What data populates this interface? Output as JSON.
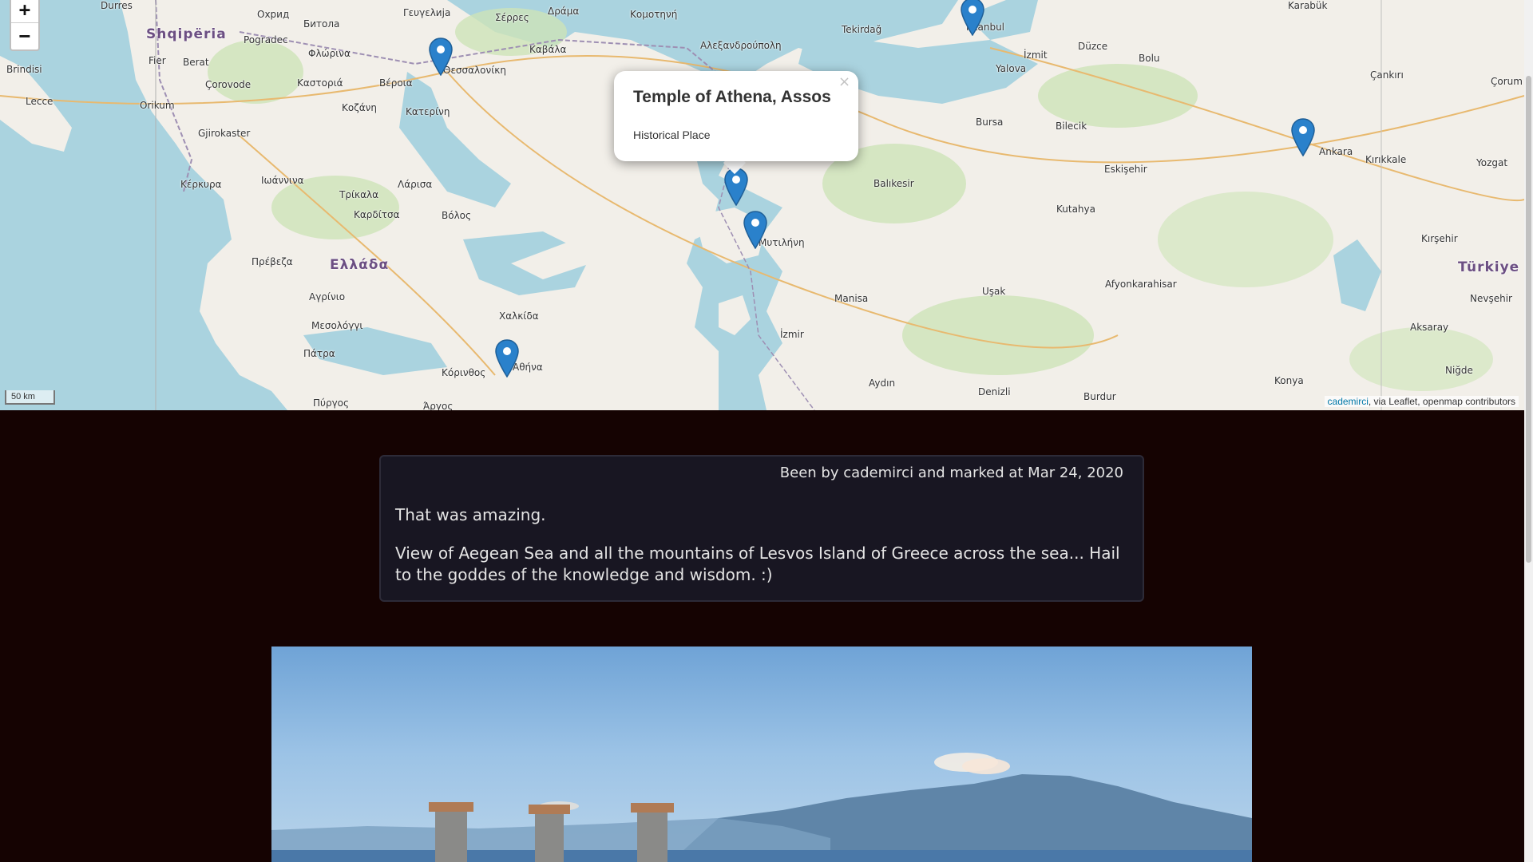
{
  "map": {
    "zoom_in": "+",
    "zoom_out": "−",
    "scale": "50 km",
    "attribution": {
      "link": "cademirci",
      "rest": ", via Leaflet, openmap contributors"
    },
    "popup": {
      "close": "×",
      "title": "Temple of Athena, Assos",
      "subtitle": "Historical Place"
    },
    "places": [
      {
        "name": "Durres"
      },
      {
        "name": "Shqipëria"
      },
      {
        "name": "Охрид"
      },
      {
        "name": "Битола"
      },
      {
        "name": "Pogradec"
      },
      {
        "name": "Fier"
      },
      {
        "name": "Berat"
      },
      {
        "name": "Brindisi"
      },
      {
        "name": "Lecce"
      },
      {
        "name": "Orikum"
      },
      {
        "name": "Çorovode"
      },
      {
        "name": "Gjirokaster"
      },
      {
        "name": "Κέρκυρα"
      },
      {
        "name": "Ιωάννινα"
      },
      {
        "name": "Φλώρινα"
      },
      {
        "name": "Καστοριά"
      },
      {
        "name": "Κοζάνη"
      },
      {
        "name": "Βέροια"
      },
      {
        "name": "Κατερίνη"
      },
      {
        "name": "Θεσσαλονίκη"
      },
      {
        "name": "Γευγελија"
      },
      {
        "name": "Σέρρες"
      },
      {
        "name": "Δράμα"
      },
      {
        "name": "Καβάλα"
      },
      {
        "name": "Κομοτηνή"
      },
      {
        "name": "Αλεξανδρούπολη"
      },
      {
        "name": "Tekirdağ"
      },
      {
        "name": "İstanbul"
      },
      {
        "name": "Karabük"
      },
      {
        "name": "İzmit"
      },
      {
        "name": "Düzce"
      },
      {
        "name": "Bolu"
      },
      {
        "name": "Yalova"
      },
      {
        "name": "Çankırı"
      },
      {
        "name": "Çorum"
      },
      {
        "name": "Bursa"
      },
      {
        "name": "Bilecik"
      },
      {
        "name": "Ankara"
      },
      {
        "name": "Kırıkkale"
      },
      {
        "name": "Yozgat"
      },
      {
        "name": "Eskişehir"
      },
      {
        "name": "Balıkesir"
      },
      {
        "name": "Kutahya"
      },
      {
        "name": "Τρίκαλα"
      },
      {
        "name": "Λάρισα"
      },
      {
        "name": "Καρδίτσα"
      },
      {
        "name": "Βόλος"
      },
      {
        "name": "Πρέβεζα"
      },
      {
        "name": "Ελλάδα"
      },
      {
        "name": "Μυτιλήνη"
      },
      {
        "name": "Kırşehir"
      },
      {
        "name": "Türkiye"
      },
      {
        "name": "Nevşehir"
      },
      {
        "name": "Afyonkarahisar"
      },
      {
        "name": "Uşak"
      },
      {
        "name": "Manisa"
      },
      {
        "name": "Αγρίνιο"
      },
      {
        "name": "Χαλκίδα"
      },
      {
        "name": "Μεσολόγγι"
      },
      {
        "name": "Πάτρα"
      },
      {
        "name": "Αθήνα"
      },
      {
        "name": "Κόρινθος"
      },
      {
        "name": "Πύργος"
      },
      {
        "name": "Άργος"
      },
      {
        "name": "İzmir"
      },
      {
        "name": "Aydın"
      },
      {
        "name": "Denizli"
      },
      {
        "name": "Burdur"
      },
      {
        "name": "Konya"
      },
      {
        "name": "Aksaray"
      },
      {
        "name": "Niğde"
      }
    ]
  },
  "post": {
    "meta": "Been by cademirci and marked at Mar 24, 2020",
    "line1": "That was amazing.",
    "body": "View of Aegean Sea and all the mountains of Lesvos Island of Greece across the sea... Hail to the goddes of the knowledge and wisdom. :)"
  },
  "colors": {
    "page_bg": "#150302",
    "card_bg": "#181622",
    "sea": "#aad3df",
    "marker": "#2a81cb",
    "link": "#0078a8"
  }
}
